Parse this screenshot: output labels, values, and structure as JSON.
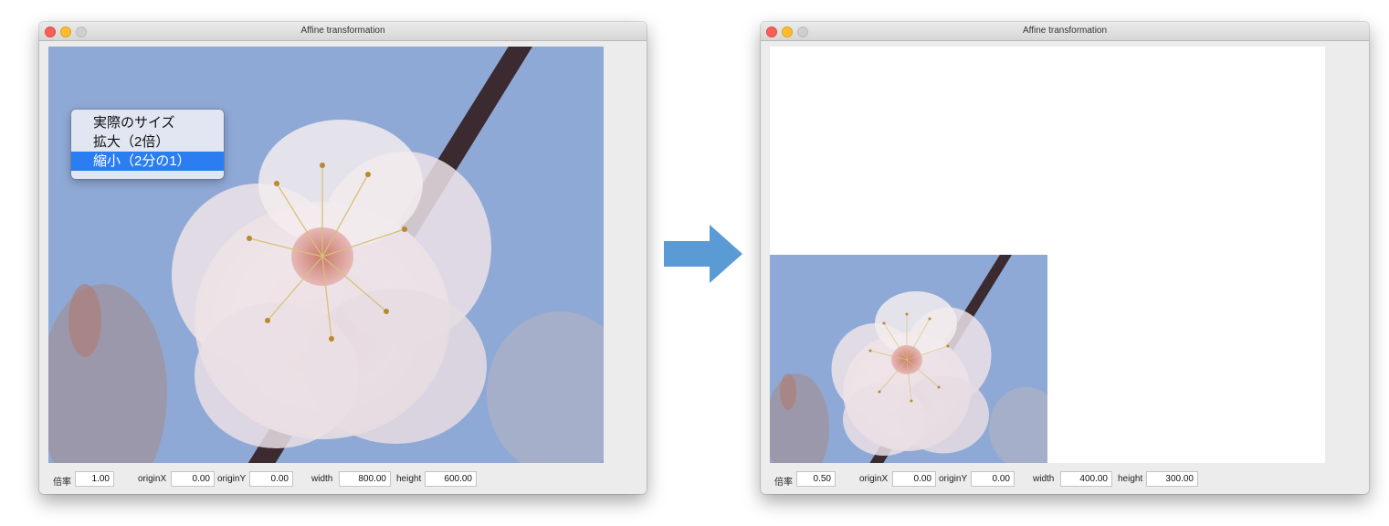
{
  "arrow_color": "#5b9bd5",
  "left_window": {
    "title": "Affine transformation",
    "context_menu": {
      "items": [
        "実際のサイズ",
        "拡大（2倍）",
        "縮小（2分の1）"
      ],
      "selected_index": 2
    },
    "controls": {
      "scale_label": "倍率",
      "scale_value": "1.00",
      "originx_label": "originX",
      "originx_value": "0.00",
      "originy_label": "originY",
      "originy_value": "0.00",
      "width_label": "width",
      "width_value": "800.00",
      "height_label": "height",
      "height_value": "600.00"
    }
  },
  "right_window": {
    "title": "Affine transformation",
    "controls": {
      "scale_label": "倍率",
      "scale_value": "0.50",
      "originx_label": "originX",
      "originx_value": "0.00",
      "originy_label": "originY",
      "originy_value": "0.00",
      "width_label": "width",
      "width_value": "400.00",
      "height_label": "height",
      "height_value": "300.00"
    }
  }
}
